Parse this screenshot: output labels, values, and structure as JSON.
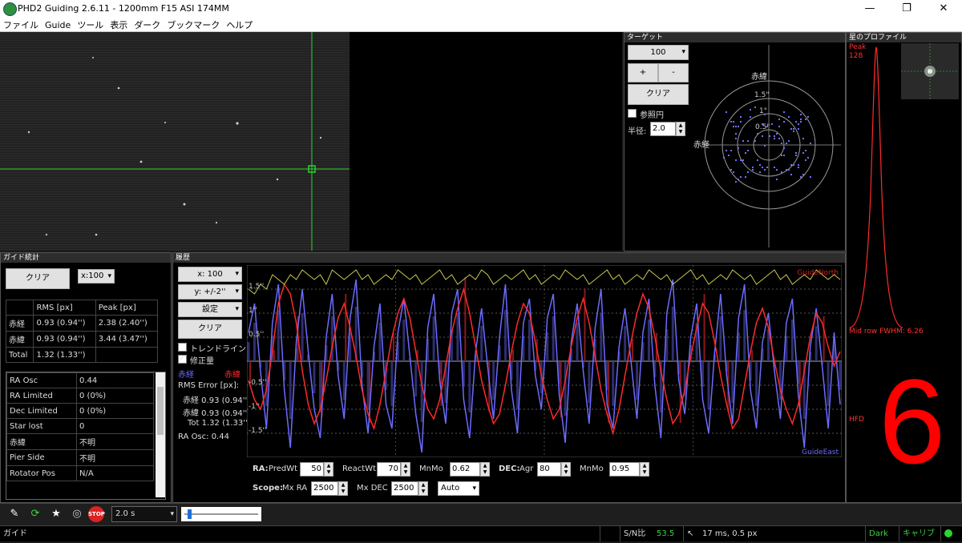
{
  "window": {
    "title": "PHD2 Guiding 2.6.11 - 1200mm F15 ASI 174MM",
    "minimize": "—",
    "maximize": "❐",
    "close": "✕"
  },
  "menu": [
    "ファイル",
    "Guide",
    "ツール",
    "表示",
    "ダーク",
    "ブックマーク",
    "ヘルプ"
  ],
  "target": {
    "title": "ターゲット",
    "scale": "100",
    "plus": "+",
    "minus": "-",
    "clear": "クリア",
    "ref_circle": "参照円",
    "radius_label": "半径:",
    "radius_value": "2.0",
    "dec_label": "赤緯",
    "ra_label": "赤経",
    "ring_labels": [
      "1.5\"",
      "1\"",
      "0.5\""
    ]
  },
  "profile": {
    "title": "星のプロファイル",
    "peak_label": "Peak",
    "peak_value": "128",
    "fwhm": "Mid row FWHM: 6.26",
    "hfd_label": "HFD",
    "hfd_value": "6"
  },
  "stats": {
    "title": "ガイド統計",
    "clear": "クリア",
    "scale": "x:100",
    "headers": [
      "",
      "RMS [px]",
      "Peak [px]"
    ],
    "rows": [
      [
        "赤経",
        "0.93 (0.94'')",
        "2.38 (2.40'')"
      ],
      [
        "赤緯",
        "0.93 (0.94'')",
        "3.44 (3.47'')"
      ],
      [
        "Total",
        "1.32 (1.33'')",
        ""
      ]
    ],
    "info": [
      [
        "RA Osc",
        "0.44"
      ],
      [
        "RA Limited",
        "0 (0%)"
      ],
      [
        "Dec Limited",
        "0 (0%)"
      ],
      [
        "Star lost",
        "0"
      ],
      [
        "赤緯",
        "不明"
      ],
      [
        "Pier Side",
        "不明"
      ],
      [
        "Rotator Pos",
        "N/A"
      ]
    ]
  },
  "history": {
    "title": "履歴",
    "x_scale": "x: 100",
    "y_scale": "y: +/-2''",
    "settings": "設定",
    "clear": "クリア",
    "trendline": "トレンドライン",
    "corrections": "修正量",
    "legend_ra": "赤経",
    "legend_dec": "赤緯",
    "rms_title": "RMS Error [px]:",
    "rms_ra": "赤経 0.93 (0.94'')",
    "rms_dec": "赤緯 0.93 (0.94'')",
    "rms_tot": "Tot 1.32 (1.33'')",
    "ra_osc": "RA Osc: 0.44",
    "guide_north": "GuideNorth",
    "guide_east": "GuideEast",
    "y_ticks": [
      "1.5''",
      "1''",
      "0.5''",
      "-0.5''",
      "-1''",
      "-1.5''"
    ]
  },
  "params": {
    "ra_label": "RA:",
    "predwt_label": "PredWt",
    "predwt": "50",
    "reactwt_label": "ReactWt",
    "reactwt": "70",
    "mnmo_label": "MnMo",
    "mnmo_ra": "0.62",
    "dec_label": "DEC:",
    "agr_label": "Agr",
    "agr": "80",
    "mnmo_dec": "0.95",
    "scope_label": "Scope:",
    "mxra_label": "Mx RA",
    "mxra": "2500",
    "mxdec_label": "Mx DEC",
    "mxdec": "2500",
    "mode": "Auto"
  },
  "toolbar": {
    "exposure": "2.0 s",
    "stop": "STOP"
  },
  "status": {
    "left": "ガイド",
    "snr_label": "S/N比",
    "snr_value": "53.5",
    "pulse": "17 ms, 0.5 px",
    "dark": "Dark",
    "calib": "キャリブ"
  },
  "colors": {
    "ra": "#6b6bff",
    "dec": "#ff2a2a",
    "snr": "#c8c850",
    "crosshair": "#2fd22f",
    "hfd": "#ff0000"
  },
  "chart_data": {
    "type": "line",
    "ylim": [
      -2,
      2
    ],
    "x": [
      1,
      2,
      3,
      4,
      5,
      6,
      7,
      8,
      9,
      10,
      11,
      12,
      13,
      14,
      15,
      16,
      17,
      18,
      19,
      20,
      21,
      22,
      23,
      24,
      25,
      26,
      27,
      28,
      29,
      30,
      31,
      32,
      33,
      34,
      35,
      36,
      37,
      38,
      39,
      40,
      41,
      42,
      43,
      44,
      45,
      46,
      47,
      48,
      49,
      50,
      51,
      52,
      53,
      54,
      55,
      56,
      57,
      58,
      59,
      60,
      61,
      62,
      63,
      64,
      65,
      66,
      67,
      68,
      69,
      70,
      71,
      72,
      73,
      74,
      75,
      76,
      77,
      78,
      79,
      80,
      81,
      82,
      83,
      84,
      85,
      86,
      87,
      88,
      89,
      90,
      91,
      92,
      93,
      94,
      95,
      96,
      97,
      98,
      99,
      100
    ],
    "series": [
      {
        "name": "赤経",
        "values": [
          0.6,
          1.2,
          -0.2,
          -1.4,
          0.8,
          1.6,
          -0.6,
          -1.8,
          0.4,
          1.5,
          0.2,
          -1.0,
          -1.6,
          0.5,
          1.4,
          -0.3,
          -1.2,
          0.9,
          1.7,
          -0.5,
          -1.5,
          0.3,
          1.2,
          -0.9,
          -1.4,
          0.6,
          1.3,
          0.1,
          -1.1,
          -1.9,
          0.7,
          1.4,
          -0.4,
          -1.3,
          1.0,
          1.5,
          -0.8,
          -1.6,
          0.2,
          1.1,
          -0.1,
          -1.2,
          0.5,
          1.6,
          -0.6,
          -1.5,
          0.8,
          1.3,
          -0.3,
          -1.0,
          0.9,
          1.4,
          -0.7,
          -1.7,
          0.4,
          1.2,
          -0.2,
          -1.3,
          0.7,
          1.5,
          -0.9,
          -1.4,
          0.3,
          1.1,
          0.0,
          -1.2,
          0.6,
          1.3,
          -0.5,
          -1.6,
          1.0,
          1.7,
          -0.4,
          -1.1,
          0.5,
          1.2,
          -0.8,
          -1.5,
          0.2,
          1.4,
          -0.3,
          -1.3,
          0.9,
          1.6,
          -0.6,
          -1.4,
          0.4,
          1.0,
          -0.2,
          -1.2,
          0.8,
          1.3,
          -0.7,
          -1.8,
          0.3,
          1.1,
          -0.1,
          -1.4,
          0.6,
          -0.9
        ]
      },
      {
        "name": "赤緯",
        "values": [
          -0.4,
          -0.8,
          -1.0,
          -0.6,
          0.2,
          1.2,
          1.6,
          1.4,
          0.8,
          -0.2,
          -0.9,
          -1.3,
          -1.0,
          -0.4,
          0.3,
          0.9,
          1.2,
          0.7,
          0.1,
          -0.6,
          -1.1,
          -1.4,
          -0.9,
          -0.2,
          0.5,
          1.0,
          1.3,
          0.9,
          0.2,
          -0.5,
          -1.0,
          -1.2,
          -0.8,
          -0.1,
          0.6,
          1.1,
          1.5,
          1.0,
          0.3,
          -0.4,
          -0.9,
          -1.3,
          -1.1,
          -0.5,
          0.2,
          0.8,
          1.2,
          1.0,
          0.4,
          -0.3,
          -0.8,
          -1.2,
          -1.0,
          -0.4,
          0.3,
          0.9,
          1.3,
          0.8,
          0.1,
          -0.6,
          -1.1,
          -1.5,
          -1.0,
          -0.3,
          0.4,
          1.0,
          1.4,
          1.1,
          0.5,
          -0.2,
          -0.8,
          -1.3,
          -1.1,
          -0.6,
          0.1,
          0.7,
          1.2,
          1.0,
          0.4,
          -0.3,
          -0.9,
          -1.4,
          -1.2,
          -0.5,
          0.2,
          0.8,
          1.1,
          0.7,
          0.0,
          -0.6,
          -1.0,
          -1.3,
          -0.9,
          -0.2,
          0.5,
          1.0,
          0.8,
          0.3,
          -0.1,
          0.2
        ]
      },
      {
        "name": "S/N",
        "values": [
          1.5,
          1.4,
          1.6,
          1.5,
          1.8,
          1.7,
          1.6,
          1.8,
          1.7,
          1.9,
          1.8,
          1.7,
          1.8,
          1.6,
          1.9,
          1.8,
          1.7,
          1.8,
          1.9,
          1.7,
          1.8,
          1.6,
          1.7,
          1.8,
          1.7,
          1.9,
          1.8,
          1.7,
          1.8,
          1.6,
          1.7,
          1.8,
          1.9,
          1.7,
          1.8,
          1.6,
          1.7,
          1.8,
          1.7,
          1.9,
          1.8,
          1.6,
          1.7,
          1.8,
          1.7,
          1.8,
          1.9,
          1.7,
          1.8,
          1.6,
          1.7,
          1.8,
          1.7,
          1.9,
          1.8,
          1.7,
          1.8,
          1.6,
          1.7,
          1.8,
          1.9,
          1.7,
          1.8,
          1.6,
          1.7,
          1.8,
          1.7,
          1.9,
          1.8,
          1.7,
          1.8,
          1.6,
          1.7,
          1.8,
          1.9,
          1.7,
          1.8,
          1.6,
          1.7,
          1.8,
          1.7,
          1.9,
          1.8,
          1.7,
          1.8,
          1.6,
          1.7,
          1.8,
          1.9,
          1.7,
          1.8,
          1.6,
          1.7,
          1.8,
          1.7,
          1.9,
          1.8,
          1.7,
          1.8,
          1.7
        ]
      }
    ]
  }
}
